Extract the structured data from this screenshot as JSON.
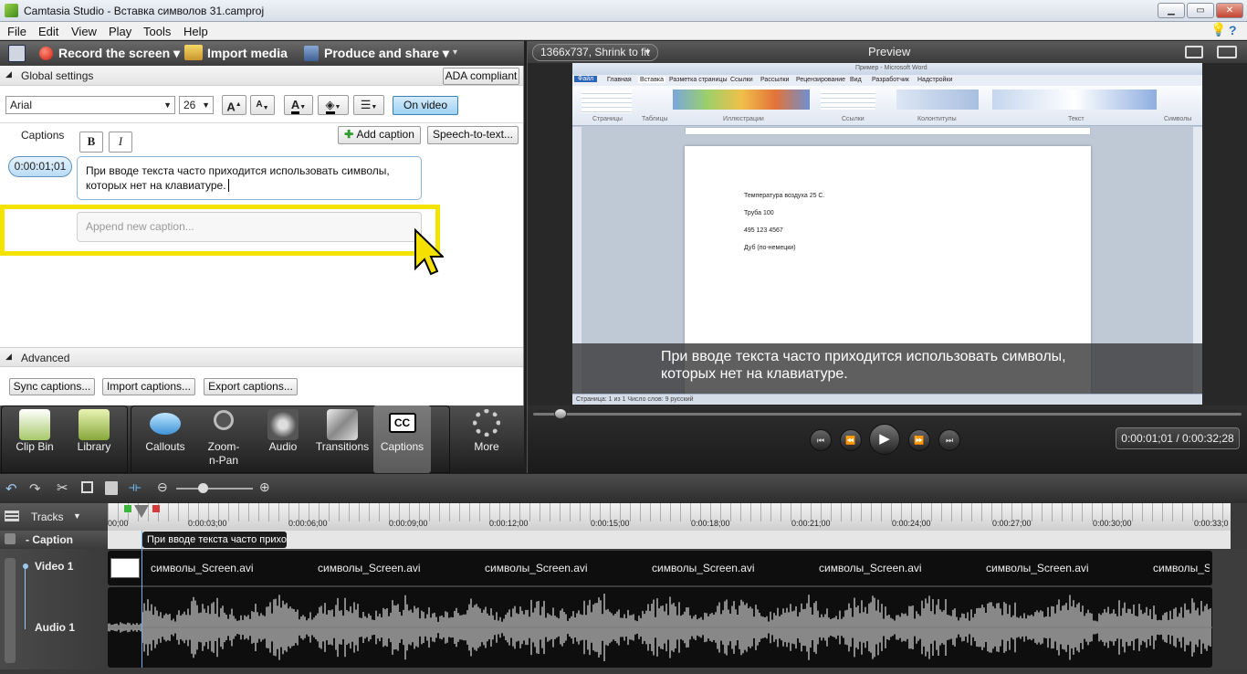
{
  "window": {
    "title": "Camtasia Studio - Вставка символов 31.camproj",
    "min": "▁",
    "max": "▭",
    "close": "✕"
  },
  "menu": [
    "File",
    "Edit",
    "View",
    "Play",
    "Tools",
    "Help"
  ],
  "toolbar": {
    "record": "Record the screen",
    "import": "Import media",
    "produce": "Produce and share"
  },
  "global_settings": {
    "header": "Global settings",
    "ada": "ADA compliant",
    "font": "Arial",
    "size": "26",
    "on_video": "On video"
  },
  "captions": {
    "label": "Captions",
    "bold": "B",
    "italic": "I",
    "add": "Add caption",
    "speech": "Speech-to-text...",
    "time": "0:00:01;01",
    "text": "При вводе текста часто приходится использовать символы, которых нет на клавиатуре.",
    "append_placeholder": "Append new caption..."
  },
  "advanced": {
    "header": "Advanced",
    "sync": "Sync captions...",
    "import": "Import captions...",
    "export": "Export captions..."
  },
  "tabs": [
    {
      "label": "Clip Bin"
    },
    {
      "label": "Library"
    },
    {
      "label": "Callouts"
    },
    {
      "label": "Zoom-n-Pan"
    },
    {
      "label": "Audio"
    },
    {
      "label": "Transitions"
    },
    {
      "label": "Captions"
    },
    {
      "label": "More"
    }
  ],
  "preview": {
    "size_select": "1366x737, Shrink to fit",
    "title": "Preview",
    "caption_overlay_l1": "При вводе текста часто приходится использовать символы,",
    "caption_overlay_l2": "которых нет на клавиатуре.",
    "time": "0:00:01;01 / 0:00:32;28",
    "progress": 0.03
  },
  "word": {
    "title": "Пример - Microsoft Word",
    "line1": "Температура воздуха 25 С.",
    "line2": "Труба 100",
    "line3": "495 123 4567",
    "line4": "Дуб (по-немецки)",
    "tabs": [
      "Файл",
      "Главная",
      "Вставка",
      "Разметка страницы",
      "Ссылки",
      "Рассылки",
      "Рецензирование",
      "Вид",
      "Разработчик",
      "Надстройки"
    ],
    "groups": [
      "Страницы",
      "Таблицы",
      "Иллюстрации",
      "Ссылки",
      "Колонтитулы",
      "Текст",
      "Символы"
    ],
    "statusbar": "Страница: 1 из 1   Число слов: 9   русский"
  },
  "timeline": {
    "tracks_label": "Tracks",
    "ruler": [
      "00;00",
      "0:00:03;00",
      "0:00:06;00",
      "0:00:09;00",
      "0:00:12;00",
      "0:00:15;00",
      "0:00:18;00",
      "0:00:21;00",
      "0:00:24;00",
      "0:00:27;00",
      "0:00:30;00",
      "0:00:33;0"
    ],
    "caption_track": "Caption",
    "caption_clip": "При вводе текста часто прихо",
    "video_track": "Video 1",
    "audio_track": "Audio 1",
    "clip_name": "символы_Screen.avi",
    "zoom_level": 0.35
  },
  "colors": {
    "highlight": "#f3e300",
    "accent": "#1f78c8"
  }
}
